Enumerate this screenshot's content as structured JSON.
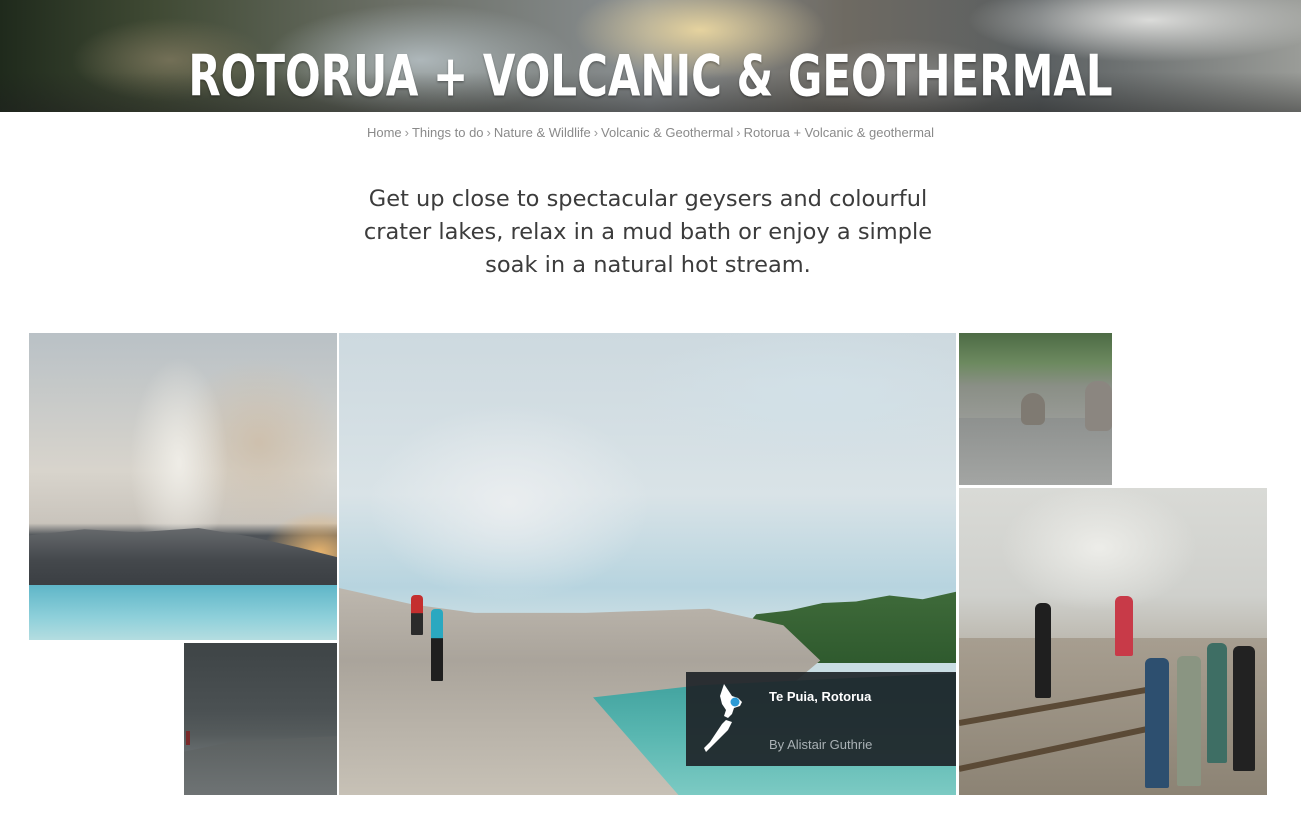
{
  "hero": {
    "title": "ROTORUA + VOLCANIC & GEOTHERMAL"
  },
  "breadcrumb": {
    "items": [
      {
        "label": "Home"
      },
      {
        "label": "Things to do"
      },
      {
        "label": "Nature & Wildlife"
      },
      {
        "label": "Volcanic & Geothermal"
      },
      {
        "label": "Rotorua + Volcanic & geothermal"
      }
    ],
    "separator": "›"
  },
  "intro": {
    "text": "Get up close to spectacular geysers and colourful crater lakes, relax in a mud bath or enjoy a simple soak in a natural hot stream."
  },
  "gallery": {
    "featured_caption": {
      "place": "Te Puia, Rotorua",
      "credit": "By Alistair Guthrie",
      "icon": "new-zealand-map-icon"
    }
  },
  "colors": {
    "caption_bg": "#1e2428",
    "breadcrumb_text": "#8a8a8a",
    "intro_text": "#3c3c3c",
    "map_marker": "#2b9ad6"
  }
}
